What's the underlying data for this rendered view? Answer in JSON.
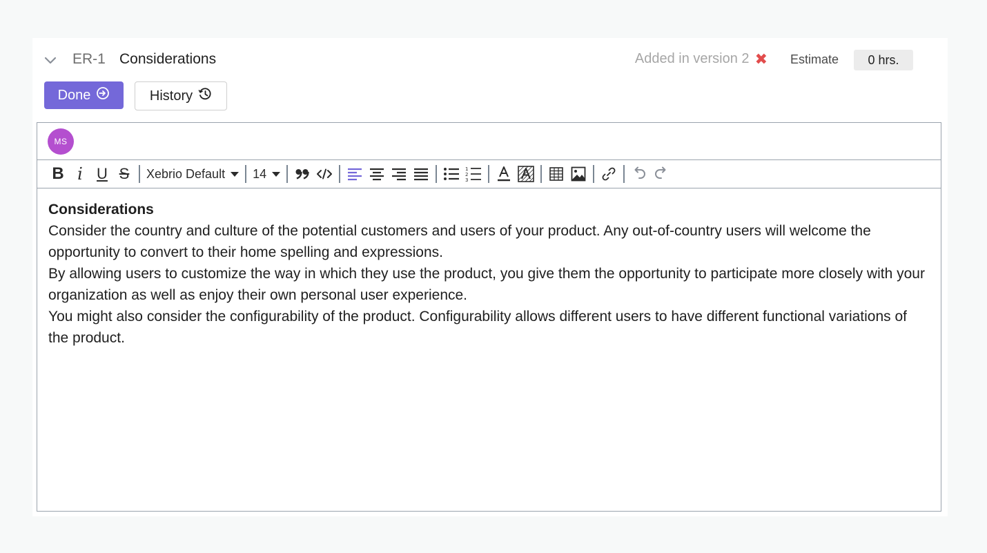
{
  "requirement": {
    "id": "ER-1",
    "title": "Considerations",
    "version_text": "Added in version 2",
    "estimate_label": "Estimate",
    "estimate_value": "0 hrs."
  },
  "actions": {
    "done_label": "Done",
    "history_label": "History"
  },
  "editor": {
    "avatar_initials": "MS",
    "avatar_color": "#b44fcf",
    "toolbar": {
      "bold": "B",
      "italic": "i",
      "underline": "U",
      "strike": "S",
      "font_family": "Xebrio Default",
      "font_size": "14"
    },
    "content": {
      "heading": "Considerations",
      "paragraphs": [
        "Consider the country and culture of the potential customers and users of your product. Any out-of-country users will welcome the opportunity to convert to their home spelling and expressions.",
        "By allowing users to customize the way in which they use the product, you give them the opportunity to participate more closely with your organization as well as enjoy their own personal user experience.",
        "You might also consider the configurability of the product. Configurability allows different users to have different functional variations of the product."
      ]
    }
  },
  "colors": {
    "accent": "#7468d9",
    "remove": "#e24c4c",
    "page_bg": "#f7f9f9"
  }
}
